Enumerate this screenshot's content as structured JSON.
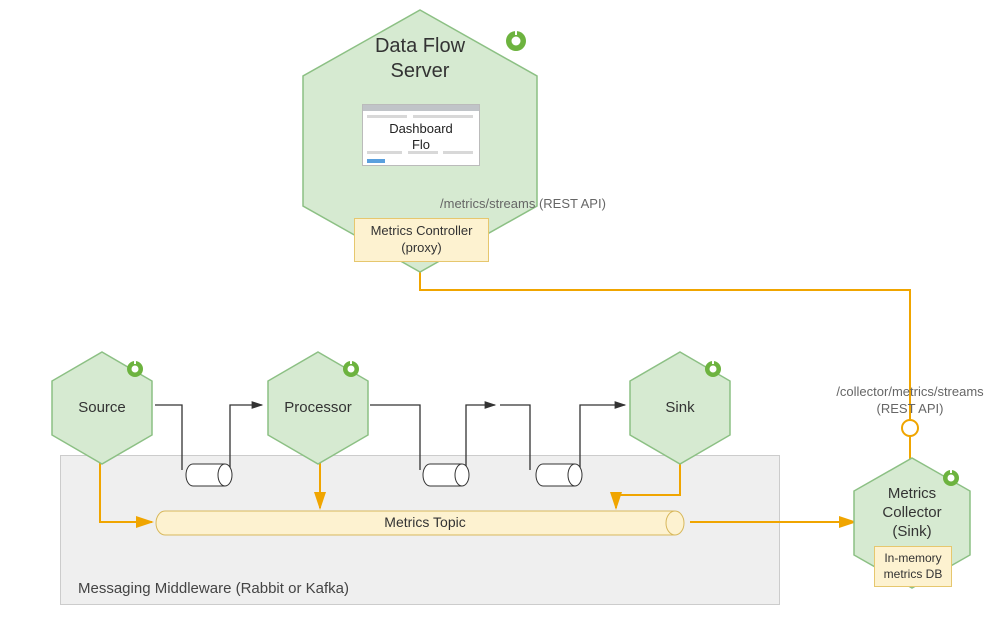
{
  "dataflow": {
    "title_line1": "Data Flow",
    "title_line2": "Server",
    "dashboard_line1": "Dashboard",
    "dashboard_line2": "Flo",
    "metrics_controller_line1": "Metrics Controller",
    "metrics_controller_line2": "(proxy)",
    "rest_api_label": "/metrics/streams (REST API)"
  },
  "collector": {
    "title_line1": "Metrics",
    "title_line2": "Collector",
    "title_line3": "(Sink)",
    "db_line1": "In-memory",
    "db_line2": "metrics DB",
    "rest_api_line1": "/collector/metrics/streams",
    "rest_api_line2": "(REST API)"
  },
  "nodes": {
    "source": "Source",
    "processor": "Processor",
    "sink": "Sink"
  },
  "middleware": {
    "label": "Messaging Middleware (Rabbit or Kafka)",
    "topic_label": "Metrics Topic"
  }
}
